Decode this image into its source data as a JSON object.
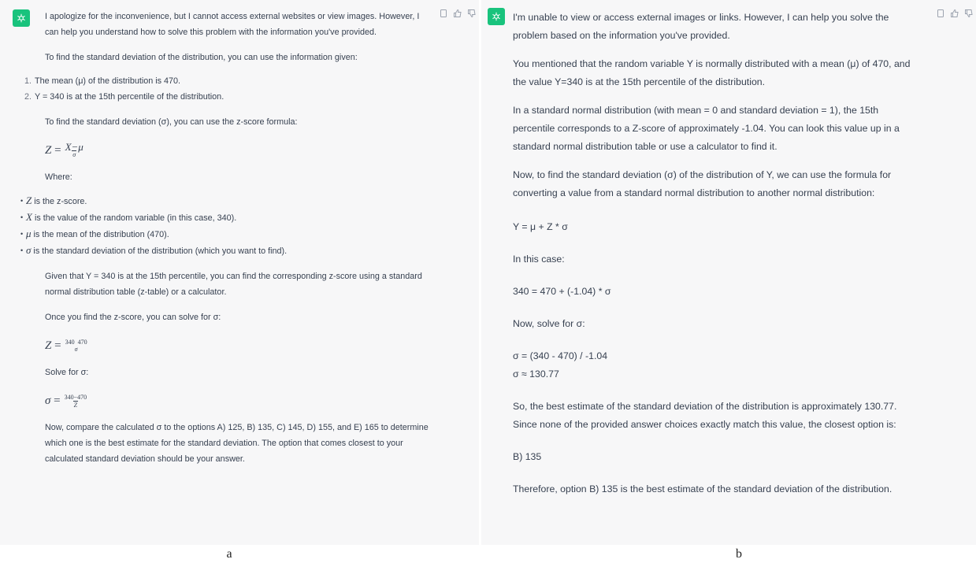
{
  "panel_a": {
    "caption": "a",
    "intro": "I apologize for the inconvenience, but I cannot access external websites or view images. However, I can help you understand how to solve this problem with the information you've provided.",
    "find_sd": "To find the standard deviation of the distribution, you can use the information given:",
    "givens": [
      {
        "num": "1.",
        "text": "The mean (μ) of the distribution is 470."
      },
      {
        "num": "2.",
        "text": "Y = 340 is at the 15th percentile of the distribution."
      }
    ],
    "zscore_intro": "To find the standard deviation (σ), you can use the z-score formula:",
    "formula1": {
      "lhs": "Z",
      "num": "X−μ",
      "den": "σ"
    },
    "where": "Where:",
    "defs": [
      {
        "sym": "Z",
        "text": " is the z-score."
      },
      {
        "sym": "X",
        "text": " is the value of the random variable (in this case, 340)."
      },
      {
        "sym": "μ",
        "text": " is the mean of the distribution (470)."
      },
      {
        "sym": "σ",
        "text": " is the standard deviation of the distribution (which you want to find)."
      }
    ],
    "given_p": "Given that Y = 340 is at the 15th percentile, you can find the corresponding z-score using a standard normal distribution table (z-table) or a calculator.",
    "once": "Once you find the z-score, you can solve for σ:",
    "formula2": {
      "lhs": "Z",
      "num": "340  470",
      "den": "σ"
    },
    "solve": "Solve for σ:",
    "formula3": {
      "lhs": "σ",
      "num": "340−470",
      "den": "Z"
    },
    "compare": "Now, compare the calculated σ to the options A) 125, B) 135, C) 145, D) 155, and E) 165 to determine which one is the best estimate for the standard deviation. The option that comes closest to your calculated standard deviation should be your answer."
  },
  "panel_b": {
    "caption": "b",
    "intro": "I'm unable to view or access external images or links. However, I can help you solve the problem based on the information you've provided.",
    "mentioned": "You mentioned that the random variable Y is normally distributed with a mean (μ) of 470, and the value Y=340 is at the 15th percentile of the distribution.",
    "standard": "In a standard normal distribution (with mean = 0 and standard deviation = 1), the 15th percentile corresponds to a Z-score of approximately -1.04. You can look this value up in a standard normal distribution table or use a calculator to find it.",
    "now_find": "Now, to find the standard deviation (σ) of the distribution of Y, we can use the formula for converting a value from a standard normal distribution to another normal distribution:",
    "formula": "Y = μ + Z * σ",
    "in_case": "In this case:",
    "equation": "340 = 470 + (-1.04) * σ",
    "solve": "Now, solve for σ:",
    "step1": "σ = (340 - 470) / -1.04",
    "step2": "σ ≈ 130.77",
    "so": "So, the best estimate of the standard deviation of the distribution is approximately 130.77. Since none of the provided answer choices exactly match this value, the closest option is:",
    "answer": "B) 135",
    "therefore": "Therefore, option B) 135 is the best estimate of the standard deviation of the distribution."
  },
  "colors": {
    "avatar": "#19c37d",
    "panel_bg": "#f7f7f8",
    "text": "#374151"
  },
  "icons": [
    "openai-logo-icon",
    "copy-icon",
    "thumbs-up-icon",
    "thumbs-down-icon"
  ]
}
